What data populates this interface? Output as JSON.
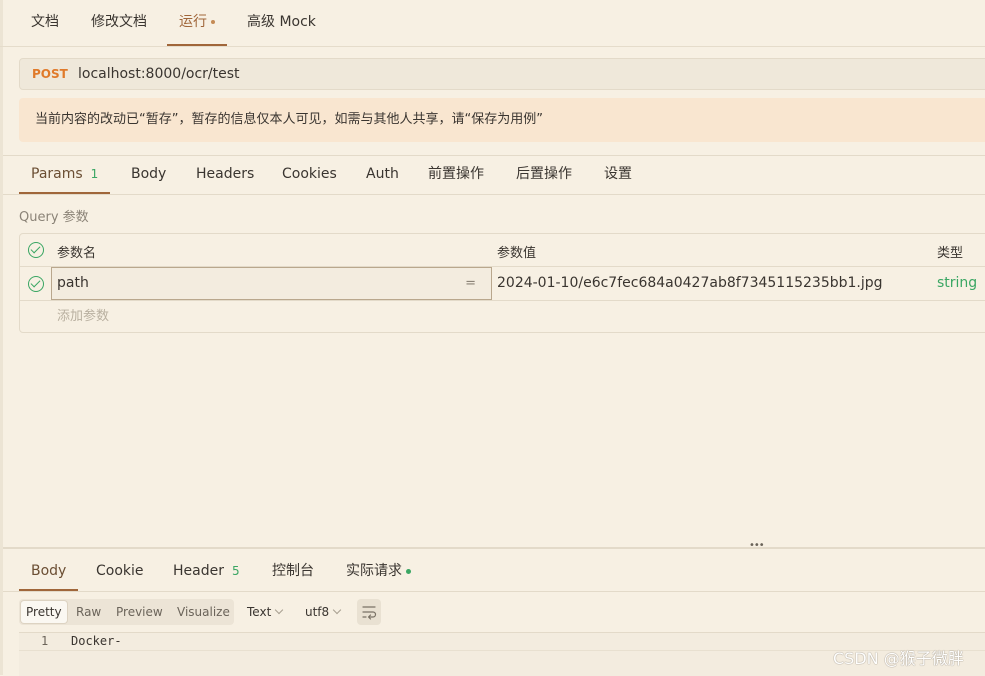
{
  "top_tabs": [
    "文档",
    "修改文档",
    "运行",
    "高级 Mock"
  ],
  "request": {
    "method": "POST",
    "url": "localhost:8000/ocr/test"
  },
  "notice": "当前内容的改动已“暂存”，暂存的信息仅本人可见，如需与其他人共享，请“保存为用例”",
  "request_tabs": {
    "params_label": "Params",
    "params_count": "1",
    "others": [
      "Body",
      "Headers",
      "Cookies",
      "Auth",
      "前置操作",
      "后置操作",
      "设置"
    ]
  },
  "query": {
    "section_label": "Query 参数",
    "headers": {
      "name": "参数名",
      "value": "参数值",
      "type": "类型"
    },
    "rows": [
      {
        "name": "path",
        "value": "2024-01-10/e6c7fec684a0427ab8f7345115235bb1.jpg",
        "type": "string",
        "enabled": true
      }
    ],
    "add_placeholder": "添加参数",
    "eq_symbol": "="
  },
  "response_tabs": {
    "body": "Body",
    "cookie": "Cookie",
    "header": "Header",
    "header_count": "5",
    "console": "控制台",
    "actual": "实际请求"
  },
  "response_toolbar": {
    "formats": [
      "Pretty",
      "Raw",
      "Preview",
      "Visualize"
    ],
    "active_format": "Pretty",
    "type": "Text",
    "encoding": "utf8"
  },
  "response_body": {
    "lines": [
      {
        "num": "1",
        "text": "Docker-"
      }
    ]
  },
  "watermark": "CSDN @猴子微胖",
  "colors": {
    "accent": "#a0663a",
    "post": "#e07a2a",
    "green": "#3aa663",
    "background": "#f7f0e3",
    "notice_bg": "#f9e6d0"
  }
}
